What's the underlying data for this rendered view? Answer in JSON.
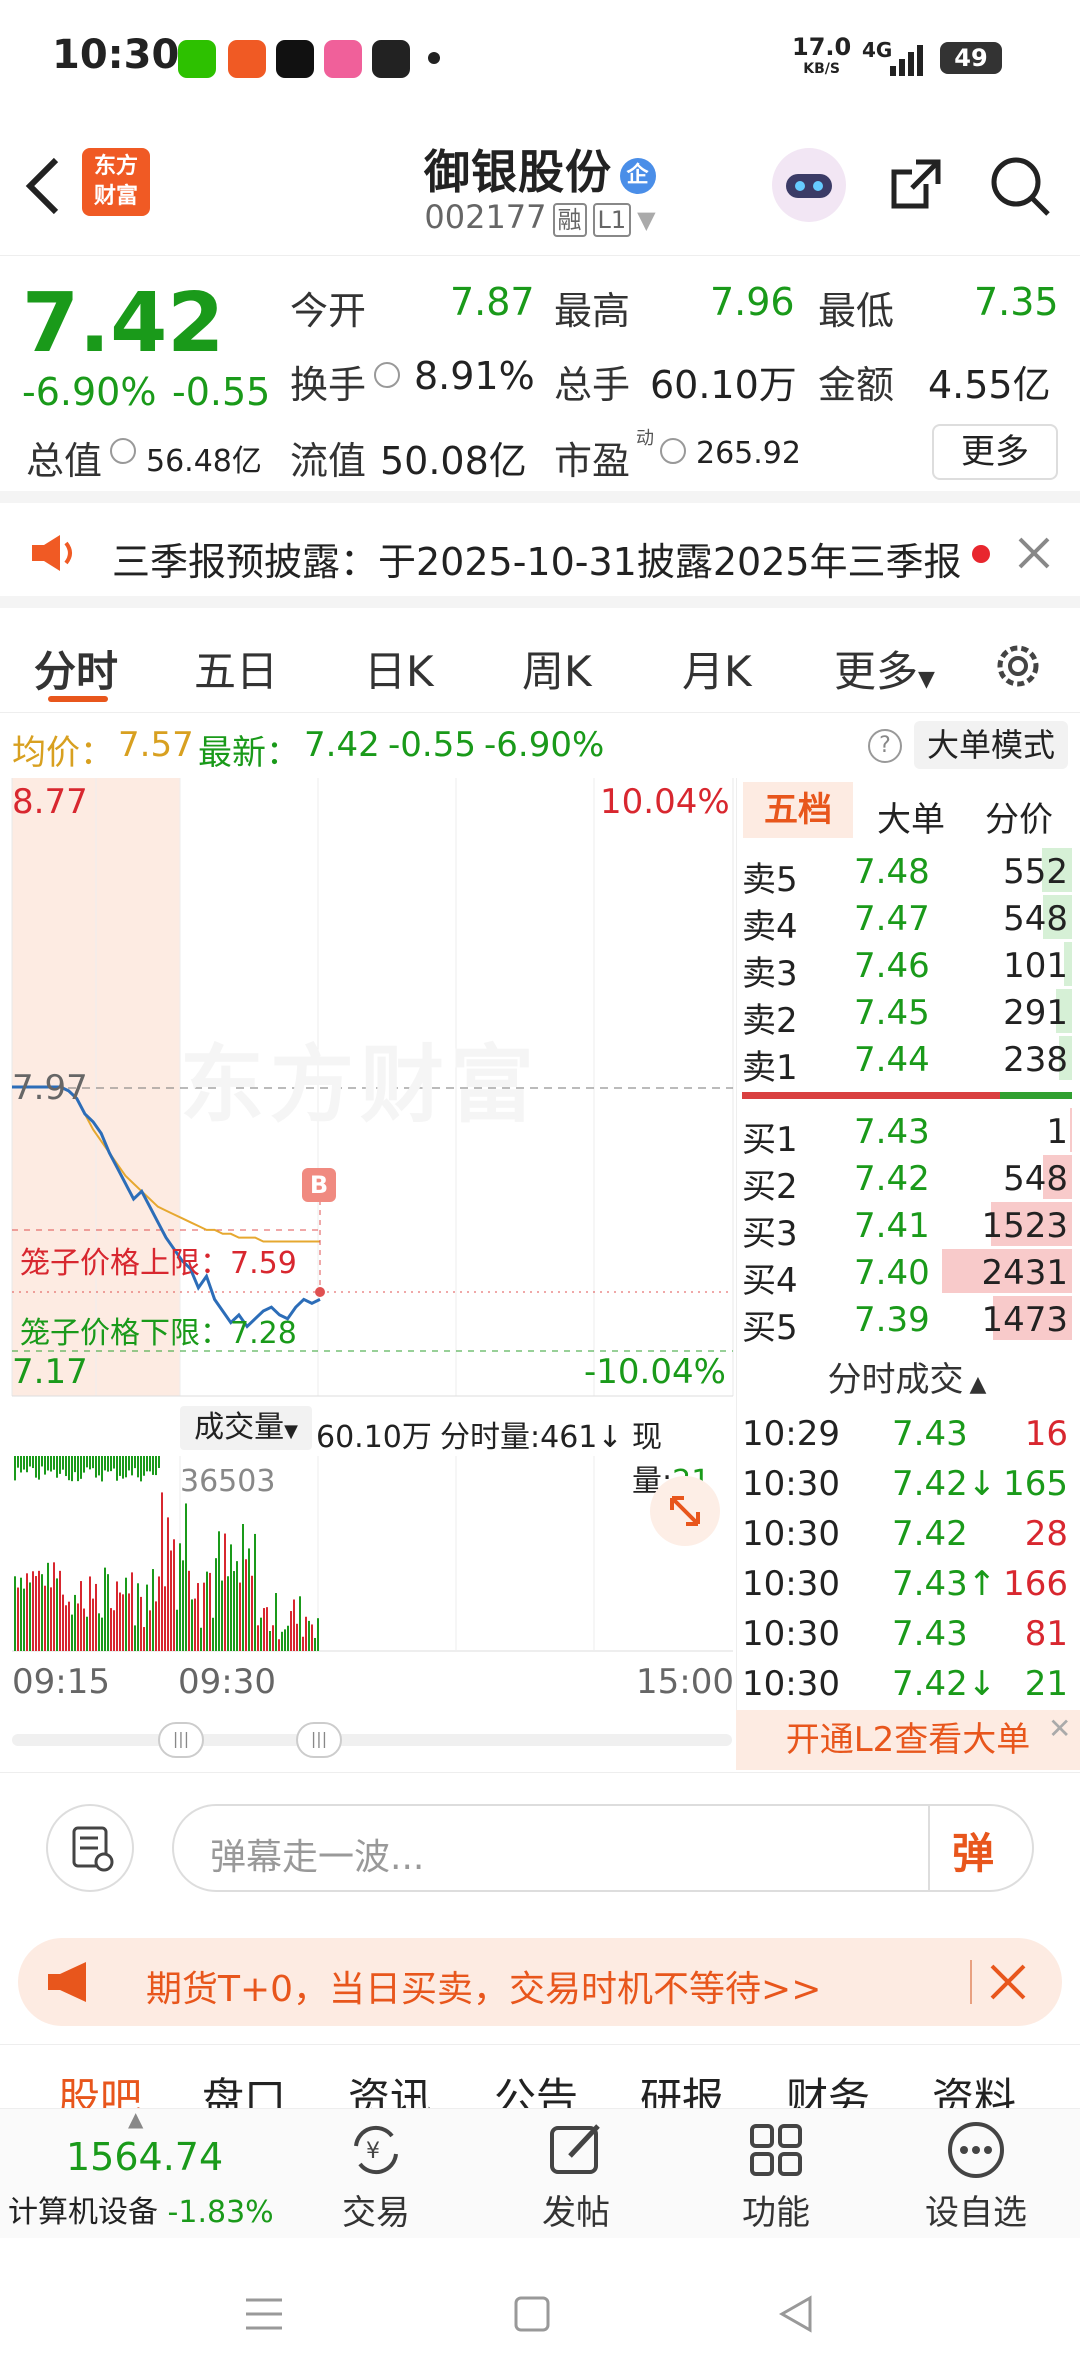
{
  "status": {
    "time": "10:30",
    "net_speed_val": "17.0",
    "net_speed_unit": "KB/S",
    "net": "4G",
    "battery": "49"
  },
  "header": {
    "logo_line1": "东方",
    "logo_line2": "财富",
    "title": "御银股份",
    "badge": "企",
    "code": "002177",
    "tag1": "融",
    "tag2": "L1"
  },
  "quote": {
    "price": "7.42",
    "change_pct": "-6.90%",
    "change": "-0.55",
    "open_lbl": "今开",
    "open": "7.87",
    "high_lbl": "最高",
    "high": "7.96",
    "low_lbl": "最低",
    "low": "7.35",
    "turnover_lbl": "换手",
    "turnover": "8.91%",
    "vol_lbl": "总手",
    "vol": "60.10万",
    "amt_lbl": "金额",
    "amt": "4.55亿",
    "mktcap_lbl": "总值",
    "mktcap": "56.48亿",
    "float_lbl": "流值",
    "float": "50.08亿",
    "pe_lbl": "市盈",
    "pe_sup": "动",
    "pe": "265.92",
    "more": "更多"
  },
  "notice": {
    "text": "三季报预披露：于2025-10-31披露2025年三季报"
  },
  "tabs": [
    "分时",
    "五日",
    "日K",
    "周K",
    "月K",
    "更多"
  ],
  "avg": {
    "avg_lbl": "均价：",
    "avg": "7.57",
    "latest_lbl": "最新：",
    "latest": "7.42",
    "chg": "-0.55",
    "pct": "-6.90%",
    "mode": "大单模式"
  },
  "chart": {
    "y_max": "8.77",
    "y_min": "7.17",
    "pct_max": "10.04%",
    "pct_min": "-10.04%",
    "prev_close": "7.97",
    "upper_lbl": "笼子价格上限：",
    "upper": "7.59",
    "lower_lbl": "笼子价格下限：",
    "lower": "7.28",
    "b_mark": "B",
    "watermark": "东方财富",
    "vol_lbl": "成交量",
    "vol_total": "60.10万",
    "fs_vol": "分时量:461↓",
    "now_vol_lbl": "现量:",
    "now_vol": "21",
    "vol_peak": "36503",
    "t_start": "09:15",
    "t_mid": "09:30",
    "t_end": "15:00"
  },
  "chart_data": {
    "type": "line",
    "x_start": "09:30",
    "ylim": [
      7.17,
      8.77
    ],
    "price": [
      7.97,
      7.97,
      7.97,
      7.97,
      7.97,
      7.97,
      7.97,
      7.96,
      7.94,
      7.9,
      7.88,
      7.85,
      7.8,
      7.76,
      7.72,
      7.68,
      7.7,
      7.66,
      7.62,
      7.58,
      7.55,
      7.52,
      7.5,
      7.45,
      7.48,
      7.42,
      7.39,
      7.36,
      7.38,
      7.35,
      7.37,
      7.39,
      7.4,
      7.38,
      7.37,
      7.4,
      7.42,
      7.41,
      7.42
    ],
    "avg": [
      7.97,
      7.97,
      7.97,
      7.97,
      7.97,
      7.97,
      7.97,
      7.96,
      7.94,
      7.9,
      7.86,
      7.83,
      7.8,
      7.77,
      7.74,
      7.72,
      7.7,
      7.68,
      7.66,
      7.65,
      7.64,
      7.63,
      7.62,
      7.61,
      7.6,
      7.6,
      7.59,
      7.59,
      7.58,
      7.58,
      7.58,
      7.57,
      7.57,
      7.57,
      7.57,
      7.57,
      7.57,
      7.57,
      7.57
    ]
  },
  "book": {
    "tabs": [
      "五档",
      "大单",
      "分价"
    ],
    "asks": [
      {
        "l": "卖5",
        "p": "7.48",
        "v": "552"
      },
      {
        "l": "卖4",
        "p": "7.47",
        "v": "548"
      },
      {
        "l": "卖3",
        "p": "7.46",
        "v": "101"
      },
      {
        "l": "卖2",
        "p": "7.45",
        "v": "291"
      },
      {
        "l": "卖1",
        "p": "7.44",
        "v": "238"
      }
    ],
    "bids": [
      {
        "l": "买1",
        "p": "7.43",
        "v": "1"
      },
      {
        "l": "买2",
        "p": "7.42",
        "v": "548"
      },
      {
        "l": "买3",
        "p": "7.41",
        "v": "1523"
      },
      {
        "l": "买4",
        "p": "7.40",
        "v": "2431"
      },
      {
        "l": "买5",
        "p": "7.39",
        "v": "1473"
      }
    ],
    "ticks_title": "分时成交",
    "ticks": [
      {
        "t": "10:29",
        "p": "7.43",
        "v": "16"
      },
      {
        "t": "10:30",
        "p": "7.42↓",
        "v": "165"
      },
      {
        "t": "10:30",
        "p": "7.42",
        "v": "28"
      },
      {
        "t": "10:30",
        "p": "7.43↑",
        "v": "166"
      },
      {
        "t": "10:30",
        "p": "7.43",
        "v": "81"
      },
      {
        "t": "10:30",
        "p": "7.42↓",
        "v": "21"
      }
    ],
    "l2": "开通L2查看大单"
  },
  "comment": {
    "placeholder": "弹幕走一波...",
    "btn": "弹"
  },
  "promo": {
    "text": "期货T+0，当日买卖，交易时机不等待>>"
  },
  "subtabs": [
    "股吧",
    "盘口",
    "资讯",
    "公告",
    "研报",
    "财务",
    "资料"
  ],
  "nav": {
    "index_val": "1564.74",
    "index_name": "计算机设备",
    "index_pct": "-1.83%",
    "items": [
      "交易",
      "发帖",
      "功能",
      "设自选"
    ]
  }
}
